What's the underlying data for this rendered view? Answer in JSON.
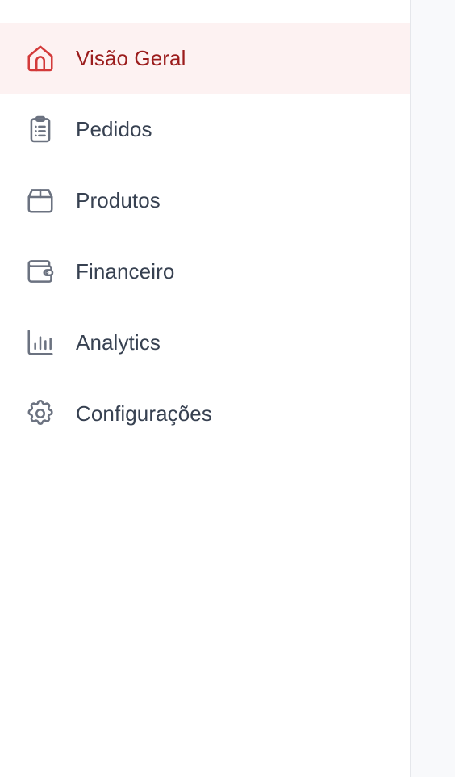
{
  "sidebar": {
    "items": [
      {
        "label": "Visão Geral",
        "icon": "home-icon",
        "active": true
      },
      {
        "label": "Pedidos",
        "icon": "clipboard-list-icon",
        "active": false
      },
      {
        "label": "Produtos",
        "icon": "box-icon",
        "active": false
      },
      {
        "label": "Financeiro",
        "icon": "wallet-icon",
        "active": false
      },
      {
        "label": "Analytics",
        "icon": "bar-chart-icon",
        "active": false
      },
      {
        "label": "Configurações",
        "icon": "gear-icon",
        "active": false
      }
    ]
  },
  "colors": {
    "active_text": "#9b1c1c",
    "active_icon": "#d33a3a",
    "active_bg": "#fdf2f2",
    "text": "#374151",
    "icon": "#6b7280"
  }
}
